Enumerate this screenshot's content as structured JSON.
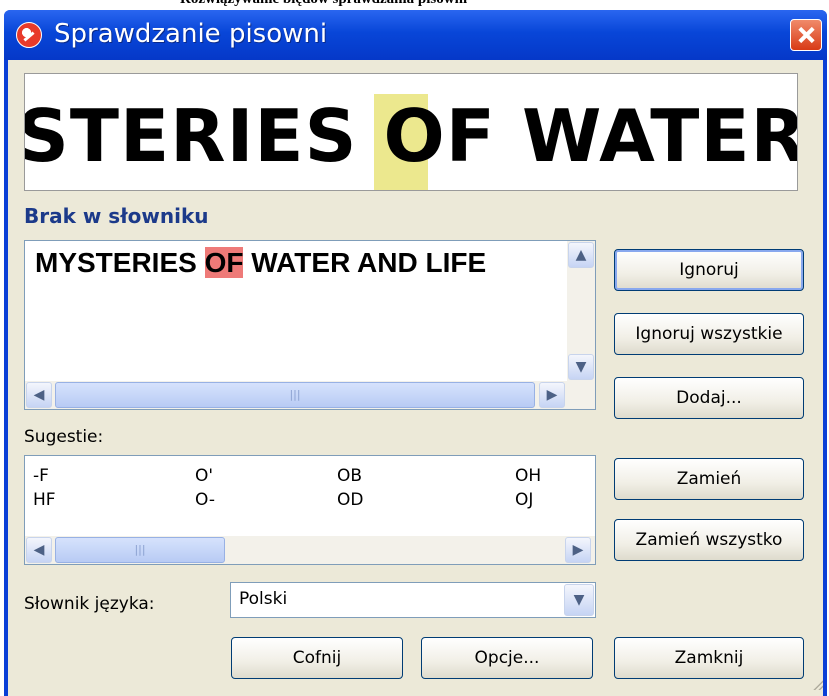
{
  "window": {
    "title": "Sprawdzanie pisowni",
    "top_cut_text": "Rozwiązywanie błędów sprawdzania pisowni"
  },
  "preview": {
    "text": "STERIES OF WATER A"
  },
  "not_in_dictionary": {
    "label": "Brak w słowniku",
    "before": "MYSTERIES ",
    "highlight": "OF",
    "after": " WATER AND LIFE"
  },
  "suggestions": {
    "label": "Sugestie:",
    "items": [
      [
        "-F",
        "O'",
        "OB",
        "OH"
      ],
      [
        "HF",
        "O-",
        "OD",
        "OJ"
      ]
    ]
  },
  "language": {
    "label": "Słownik języka:",
    "value": "Polski"
  },
  "buttons": {
    "ignore": "Ignoruj",
    "ignore_all": "Ignoruj wszystkie",
    "add": "Dodaj...",
    "replace": "Zamień",
    "replace_all": "Zamień wszystko",
    "undo": "Cofnij",
    "options": "Opcje...",
    "close": "Zamknij"
  },
  "icons": {
    "app": "spellcheck-icon",
    "close": "close-icon",
    "scroll_up": "arrow-up-icon",
    "scroll_down": "arrow-down-icon",
    "scroll_left": "arrow-left-icon",
    "scroll_right": "arrow-right-icon",
    "dropdown": "chevron-down-icon"
  },
  "colors": {
    "title_bar": "#0a46d8",
    "highlight_error": "#ee7a78",
    "highlight_preview": "#ece88e",
    "dialog_bg": "#ece9d8"
  }
}
